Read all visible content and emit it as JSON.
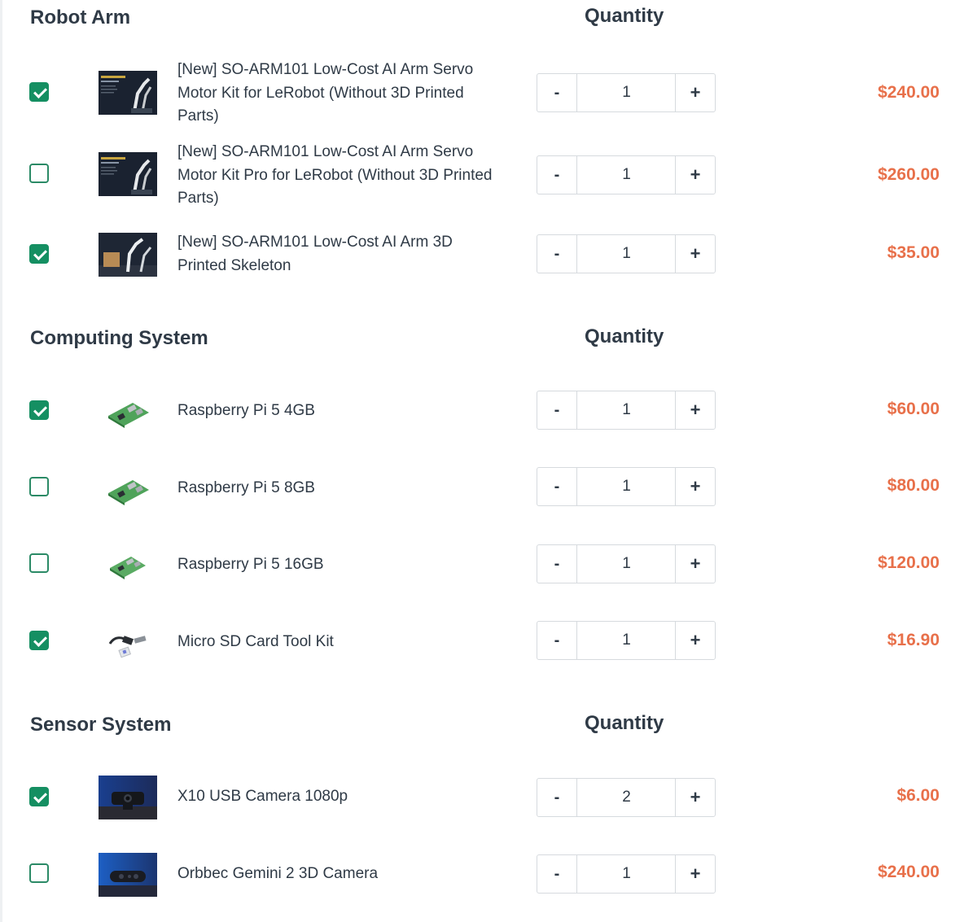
{
  "colors": {
    "accent_green": "#158f62",
    "price_orange": "#e8704a",
    "text": "#2f3a46",
    "border": "#d6dade"
  },
  "quantity_header": "Quantity",
  "stepper": {
    "minus_label": "-",
    "plus_label": "+"
  },
  "sections": [
    {
      "title": "Robot Arm",
      "items": [
        {
          "name": "[New] SO-ARM101 Low-Cost AI Arm Servo Motor Kit for LeRobot (Without 3D Printed Parts)",
          "checked": true,
          "qty": "1",
          "price": "$240.00",
          "thumb": "servo-kit-box"
        },
        {
          "name": "[New] SO-ARM101 Low-Cost AI Arm Servo Motor Kit Pro for LeRobot (Without 3D Printed Parts)",
          "checked": false,
          "qty": "1",
          "price": "$260.00",
          "thumb": "servo-kit-box"
        },
        {
          "name": "[New] SO-ARM101 Low-Cost AI Arm 3D Printed Skeleton",
          "checked": true,
          "qty": "1",
          "price": "$35.00",
          "thumb": "robot-arm-photo"
        }
      ]
    },
    {
      "title": "Computing System",
      "items": [
        {
          "name": "Raspberry Pi 5 4GB",
          "checked": true,
          "qty": "1",
          "price": "$60.00",
          "thumb": "raspberry-pi-board"
        },
        {
          "name": "Raspberry Pi 5 8GB",
          "checked": false,
          "qty": "1",
          "price": "$80.00",
          "thumb": "raspberry-pi-board"
        },
        {
          "name": "Raspberry Pi 5 16GB",
          "checked": false,
          "qty": "1",
          "price": "$120.00",
          "thumb": "raspberry-pi-board"
        },
        {
          "name": "Micro SD Card Tool Kit",
          "checked": true,
          "qty": "1",
          "price": "$16.90",
          "thumb": "sd-card-kit"
        }
      ]
    },
    {
      "title": "Sensor System",
      "items": [
        {
          "name": "X10 USB Camera 1080p",
          "checked": true,
          "qty": "2",
          "price": "$6.00",
          "thumb": "usb-webcam"
        },
        {
          "name": "Orbbec Gemini 2 3D Camera",
          "checked": false,
          "qty": "1",
          "price": "$240.00",
          "thumb": "depth-camera"
        }
      ]
    }
  ]
}
